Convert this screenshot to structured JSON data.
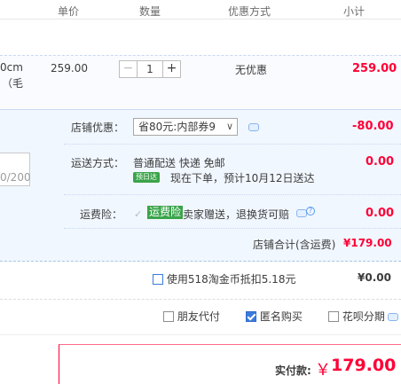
{
  "table_header": {
    "unit_price": "单价",
    "quantity": "数量",
    "discount": "优惠方式",
    "subtotal": "小计"
  },
  "item": {
    "title_frag_1": "0cm",
    "title_frag_2": "（毛",
    "price": "259.00",
    "quantity": "1",
    "minus": "−",
    "plus": "+",
    "discount": "无优惠",
    "subtotal": "259.00"
  },
  "shop": {
    "coupon_label": "店铺优惠：",
    "coupon_select": "省80元:内部券9",
    "coupon_amount": "-80.00",
    "shipping_label": "运送方式：",
    "shipping_method": "普通配送 快递 免邮",
    "delivery_badge": "预日达",
    "delivery_text": "现在下单，预计10月12日送达",
    "shipping_amount": "0.00",
    "insurance_label": "运费险：",
    "insurance_tag": "运费险",
    "insurance_text": "卖家赠送，退换货可赔",
    "insurance_amount": "0.00",
    "total_label": "店铺合计(含运费)",
    "total_value": "¥179.00",
    "message_counter": "0/200"
  },
  "coins": {
    "label": "使用518淘金币抵扣5.18元",
    "amount": "¥0.00"
  },
  "options": {
    "friend_pay": "朋友代付",
    "anonymous": "匿名购买",
    "huabei": "花呗分期"
  },
  "payment": {
    "label": "实付款:",
    "currency": "￥",
    "amount": "179.00"
  },
  "colors": {
    "accent_red": "#ff0036",
    "panel_blue": "#f1f7ff",
    "badge_green": "#3aa44a"
  }
}
